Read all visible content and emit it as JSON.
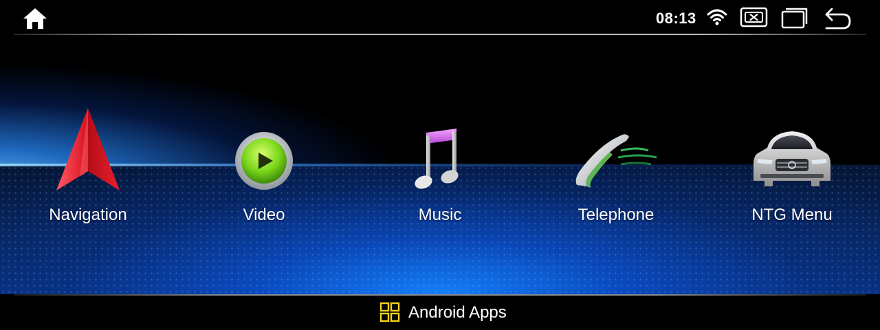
{
  "status_bar": {
    "time": "08:13",
    "icons": [
      "home-icon",
      "wifi-icon",
      "close-app-icon",
      "recent-apps-icon",
      "back-icon"
    ]
  },
  "apps": [
    {
      "label": "Navigation",
      "icon": "navigation-arrow-icon"
    },
    {
      "label": "Video",
      "icon": "play-icon"
    },
    {
      "label": "Music",
      "icon": "music-note-icon"
    },
    {
      "label": "Telephone",
      "icon": "telephone-handset-icon"
    },
    {
      "label": "NTG Menu",
      "icon": "car-icon"
    }
  ],
  "footer": {
    "label": "Android Apps",
    "icon": "app-grid-icon",
    "icon_color": "#f5d21b"
  }
}
